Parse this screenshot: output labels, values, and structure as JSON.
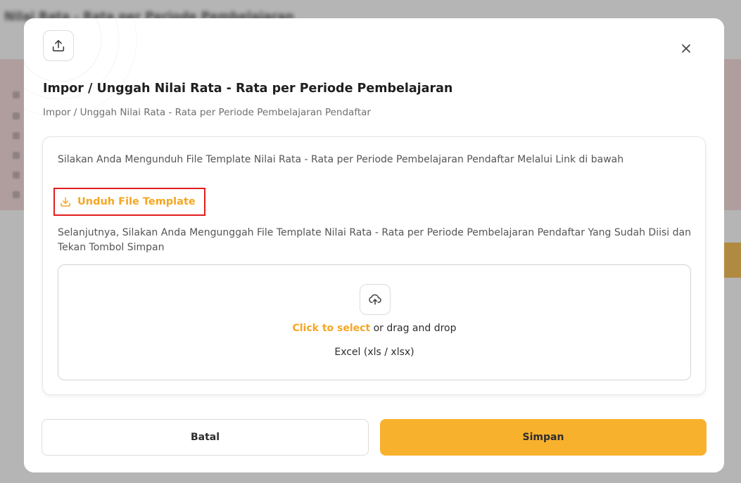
{
  "background": {
    "title": "Nilai Rata - Rata per Periode Pembelajaran"
  },
  "modal": {
    "title": "Impor / Unggah Nilai Rata - Rata per Periode Pembelajaran",
    "subtitle": "Impor / Unggah Nilai Rata - Rata per Periode Pembelajaran Pendaftar",
    "header_icon": "upload-icon",
    "close_icon": "close-icon",
    "instruction_download": "Silakan Anda Mengunduh File Template Nilai Rata - Rata per Periode Pembelajaran Pendaftar Melalui Link di bawah",
    "download_link_label": "Unduh File Template",
    "download_icon": "download-icon",
    "instruction_upload": "Selanjutnya, Silakan Anda Mengunggah File Template Nilai Rata - Rata per Periode Pembelajaran Pendaftar Yang Sudah Diisi dan Tekan Tombol Simpan",
    "dropzone": {
      "icon": "cloud-upload-icon",
      "select_label": "Click to select",
      "drag_label": " or drag and drop",
      "formats": "Excel (xls / xlsx)"
    },
    "cancel_label": "Batal",
    "save_label": "Simpan"
  },
  "colors": {
    "accent": "#F8B12D",
    "link": "#F5A623",
    "highlight_border": "#E21D1D"
  }
}
